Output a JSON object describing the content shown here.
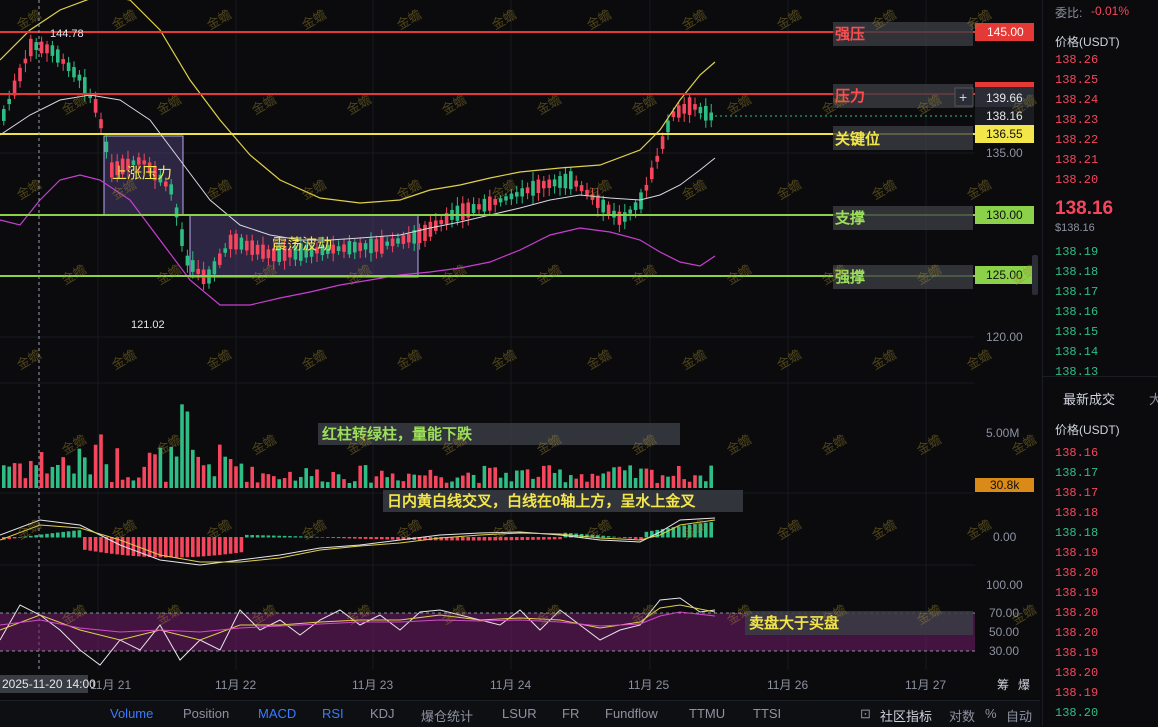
{
  "chart": {
    "price_axis": [
      "145.00",
      "139.66",
      "138.16",
      "136.55",
      "135.00",
      "130.00",
      "125.00",
      "120.00"
    ],
    "volume_axis": [
      "5.00M",
      "30.8k"
    ],
    "macd_axis": [
      "0.00"
    ],
    "rsi_axis": [
      "100.00",
      "70.00",
      "50.00",
      "30.00"
    ],
    "dates": [
      "11月 21",
      "11月 22",
      "11月 23",
      "11月 24",
      "11月 25",
      "11月 26",
      "11月 27"
    ],
    "crosshair_date": "2025-11-20 14:00",
    "high_label": "144.78",
    "low_label": "121.02",
    "level_tags": [
      "强压",
      "压力",
      "关键位",
      "支撑",
      "强撑"
    ],
    "box_labels": [
      "上涨压力",
      "震荡波动"
    ],
    "notes": {
      "volume": "红柱转绿柱，量能下跌",
      "macd": "日内黄白线交叉，白线在0轴上方，呈水上金叉",
      "rsi": "卖盘大于买盘"
    },
    "watermark": "金蟾",
    "bottom_right": [
      "筹",
      "爆"
    ]
  },
  "orderbook": {
    "weibi_label": "委比:",
    "weibi_value": "-0.01%",
    "ask_header": "价格(USDT)",
    "asks": [
      "138.26",
      "138.25",
      "138.24",
      "138.23",
      "138.22",
      "138.21",
      "138.20"
    ],
    "last_price": "138.16",
    "last_price_usd": "$138.16",
    "bids": [
      "138.19",
      "138.18",
      "138.17",
      "138.16",
      "138.15",
      "138.14",
      "138.13"
    ],
    "trades_tab": "最新成交",
    "trades_tab_more": "大",
    "trades_header": "价格(USDT)",
    "trades": [
      "138.16",
      "138.17",
      "138.17",
      "138.18",
      "138.18",
      "138.19",
      "138.20",
      "138.19",
      "138.20",
      "138.20",
      "138.19",
      "138.20",
      "138.19",
      "138.20"
    ],
    "colors": {
      "up": "#2ebd85",
      "down": "#f6465d"
    }
  },
  "bottom_tabs": [
    "Volume",
    "Position",
    "MACD",
    "RSI",
    "KDJ",
    "爆仓统计",
    "LSUR",
    "FR",
    "Fundflow",
    "TTMU",
    "TTSI"
  ],
  "bottom_right": {
    "community": "社区指标",
    "log": "对数",
    "pct": "%",
    "auto": "自动"
  }
}
